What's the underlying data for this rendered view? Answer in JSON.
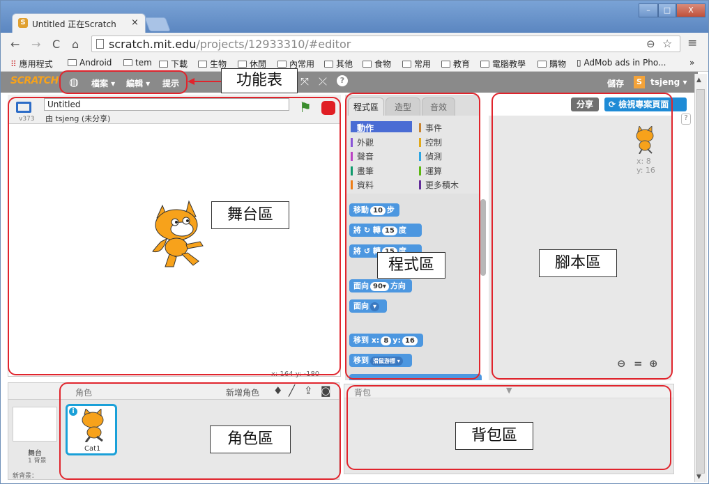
{
  "browser": {
    "tab_title": "Untitled 正在Scratch",
    "tab_close": "×",
    "url_host": "scratch.mit.edu",
    "url_path": "/projects/12933310/#editor",
    "window_buttons": [
      "–",
      "□",
      "X"
    ],
    "bookmarks": [
      "應用程式",
      "Android",
      "tem",
      "下載",
      "生物",
      "休閒",
      "內常用",
      "其他",
      "食物",
      "常用",
      "教育",
      "電腦教學",
      "購物",
      "AdMob ads in Pho...",
      "»"
    ]
  },
  "scratch": {
    "logo": "SCRATCH",
    "menus": [
      "檔案 ▾",
      "編輯 ▾",
      "提示"
    ],
    "save_label": "儲存",
    "user": "tsjeng ▾",
    "project_title": "Untitled",
    "byline": "由 tsjeng (未分享)",
    "version": "v373",
    "coords": "x: 164   y: -180",
    "palette_tabs": [
      "程式區",
      "造型",
      "音效"
    ],
    "categories_left": [
      "動作",
      "外觀",
      "聲音",
      "畫筆",
      "資料"
    ],
    "categories_right": [
      "事件",
      "控制",
      "偵測",
      "運算",
      "更多積木"
    ],
    "category_colors_left": [
      "#4a6cd4",
      "#8a55d7",
      "#bb42c3",
      "#0e9a6c",
      "#ee7d16"
    ],
    "category_colors_right": [
      "#c88330",
      "#e1a91a",
      "#2ca5e2",
      "#5cb712",
      "#632d99"
    ],
    "blocks": {
      "move": "移動",
      "move_n": "10",
      "move_unit": "步",
      "turn_r": "將 ↻ 轉",
      "turn_r_n": "15",
      "turn_unit": "度",
      "turn_l": "將 ↺ 轉",
      "turn_l_n": "15",
      "point": "面向",
      "point_n": "90▾",
      "point_unit": "方向",
      "point_to": "面向",
      "goto": "移到 x:",
      "goto_x": "8",
      "goto_y_label": "y:",
      "goto_y": "16",
      "goto_target": "移到",
      "goto_target_v": "滑鼠游標 ▾"
    },
    "share_button": "分享",
    "see_project_button": "檢視專案頁面",
    "sprite_x": "x: 8",
    "sprite_y": "y: 16",
    "sprites_label": "角色",
    "new_sprite_label": "新增角色",
    "stage_label": "舞台",
    "stage_backdrops": "1 背景",
    "new_backdrop": "新背景：",
    "sprite_name": "Cat1",
    "backpack_label": "背包",
    "help": "?"
  },
  "annotations": {
    "menu": "功能表",
    "stage": "舞台區",
    "palette": "程式區",
    "script": "腳本區",
    "sprites": "角色區",
    "backpack": "背包區"
  }
}
